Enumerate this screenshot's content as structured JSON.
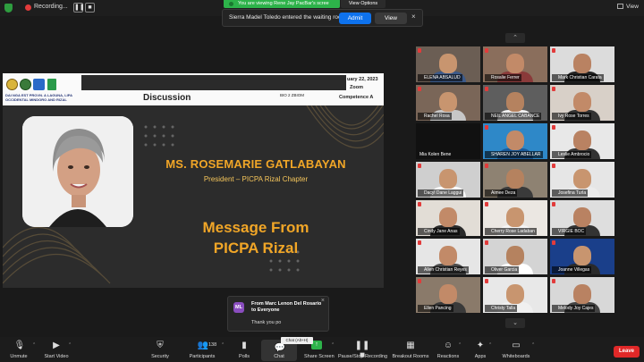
{
  "topbar": {
    "recording_label": "Recording...",
    "viewing_banner": "You are viewing Rene Jay PacBar's scree",
    "view_options": "View Options",
    "view_button": "View"
  },
  "waiting_room": {
    "message": "Sierra Madel Toledo entered the waiting room",
    "admit": "Admit",
    "view": "View",
    "close": "×"
  },
  "slide": {
    "org_text": "DAI NGA EST PROVN. A LAGUNA, LIPA OCCIDENTAL MINDORO AND RIZAL",
    "heading": "Discussion",
    "date": "uary 22, 2023",
    "platform": "Zoom",
    "venue": "BIO 2 ZBIOM",
    "competence": "Competence A",
    "speaker_name": "MS. ROSEMARIE GATLABAYAN",
    "speaker_title": "President – PICPA Rizal Chapter",
    "message_line1": "Message From",
    "message_line2": "PICPA Rizal"
  },
  "gallery": {
    "scroll_up": "⌃",
    "scroll_down": "⌄",
    "participants": [
      {
        "name": "ELENA ABSALUD",
        "skin": "#c8956f",
        "shirt": "#3c5a8a",
        "bg": "#6b5e54"
      },
      {
        "name": "Rosalie Ferrer",
        "skin": "#c28a68",
        "shirt": "#8a3a3a",
        "bg": "#8a6e5c"
      },
      {
        "name": "Mark Christian Carata",
        "skin": "#b98262",
        "shirt": "#222222",
        "bg": "#dcdcdc"
      },
      {
        "name": "Rachel Rosa",
        "skin": "#c8956f",
        "shirt": "#c7c7c7",
        "bg": "#7a6658"
      },
      {
        "name": "NEIL ANGEL CABANCE",
        "skin": "#b5825f",
        "shirt": "#f0f0f0",
        "bg": "#5e5e5e"
      },
      {
        "name": "Ivy Rose Torres",
        "skin": "#c28a68",
        "shirt": "#333333",
        "bg": "#d8d0c8"
      },
      {
        "name": "Mia Kolen Bene",
        "skin": "#000000",
        "shirt": "#000000",
        "bg": "#111111",
        "blank": true
      },
      {
        "name": "SHAREN JOY ABELLAR",
        "skin": "#c28a68",
        "shirt": "#1a5a9a",
        "bg": "#2e88c8"
      },
      {
        "name": "Leslie Ambrocio",
        "skin": "#b98262",
        "shirt": "#333333",
        "bg": "#e8e8e8"
      },
      {
        "name": "Dacyl Dane Laggui",
        "skin": "#c8956f",
        "shirt": "#ffffff",
        "bg": "#cfcfcf"
      },
      {
        "name": "Aimee Deza",
        "skin": "#b5825f",
        "shirt": "#3a3a3a",
        "bg": "#8e8272"
      },
      {
        "name": "Josefina Turla",
        "skin": "#c8956f",
        "shirt": "#ececec",
        "bg": "#e6e6e6"
      },
      {
        "name": "Cindy Jane Anas",
        "skin": "#c28a68",
        "shirt": "#2a2a2a",
        "bg": "#e2ddd6"
      },
      {
        "name": "Cherry Rose Ladaban",
        "skin": "#c8956f",
        "shirt": "#f5f5f5",
        "bg": "#ebe7e2"
      },
      {
        "name": "VIRGIE BOC",
        "skin": "#b98262",
        "shirt": "#333333",
        "bg": "#dedede"
      },
      {
        "name": "Allen Christian Reyes",
        "skin": "#c28a68",
        "shirt": "#4a4a4a",
        "bg": "#e6e6e6"
      },
      {
        "name": "Oliver Garcia",
        "skin": "#b5825f",
        "shirt": "#ffffff",
        "bg": "#d4d4d4"
      },
      {
        "name": "Joanne Villegas",
        "skin": "#c8956f",
        "shirt": "#2a2a2a",
        "bg": "#1a3f8a"
      },
      {
        "name": "Ellen Pancing",
        "skin": "#c28a68",
        "shirt": "#3a3a3a",
        "bg": "#8a7a6a"
      },
      {
        "name": "Christy Talla",
        "skin": "#c8956f",
        "shirt": "#f0f0f0",
        "bg": "#e8e8e8"
      },
      {
        "name": "Melody Joy Cajes",
        "skin": "#b98262",
        "shirt": "#444444",
        "bg": "#d8d8d8"
      }
    ]
  },
  "chat_popup": {
    "initials": "ML",
    "from": "From Marc Lenon Del Rosario to Everyone",
    "message": "Thank you po",
    "close": "×"
  },
  "toolbar": {
    "unmute": "Unmute",
    "start_video": "Start Video",
    "security": "Security",
    "participants": "Participants",
    "participants_count": "138",
    "polls": "Polls",
    "chat": "Chat",
    "chat_tooltip": "Chat (Alt+H)",
    "share_screen": "Share Screen",
    "pause_recording": "Pause/Stop Recording",
    "breakout_rooms": "Breakout Rooms",
    "reactions": "Reactions",
    "apps": "Apps",
    "whiteboards": "Whiteboards",
    "leave": "Leave"
  },
  "colors": {
    "accent_blue": "#0e72ed",
    "recording_red": "#e23b3b",
    "banner_green": "#2db34a",
    "leave_red": "#e02828",
    "slide_gold": "#f1a627"
  }
}
